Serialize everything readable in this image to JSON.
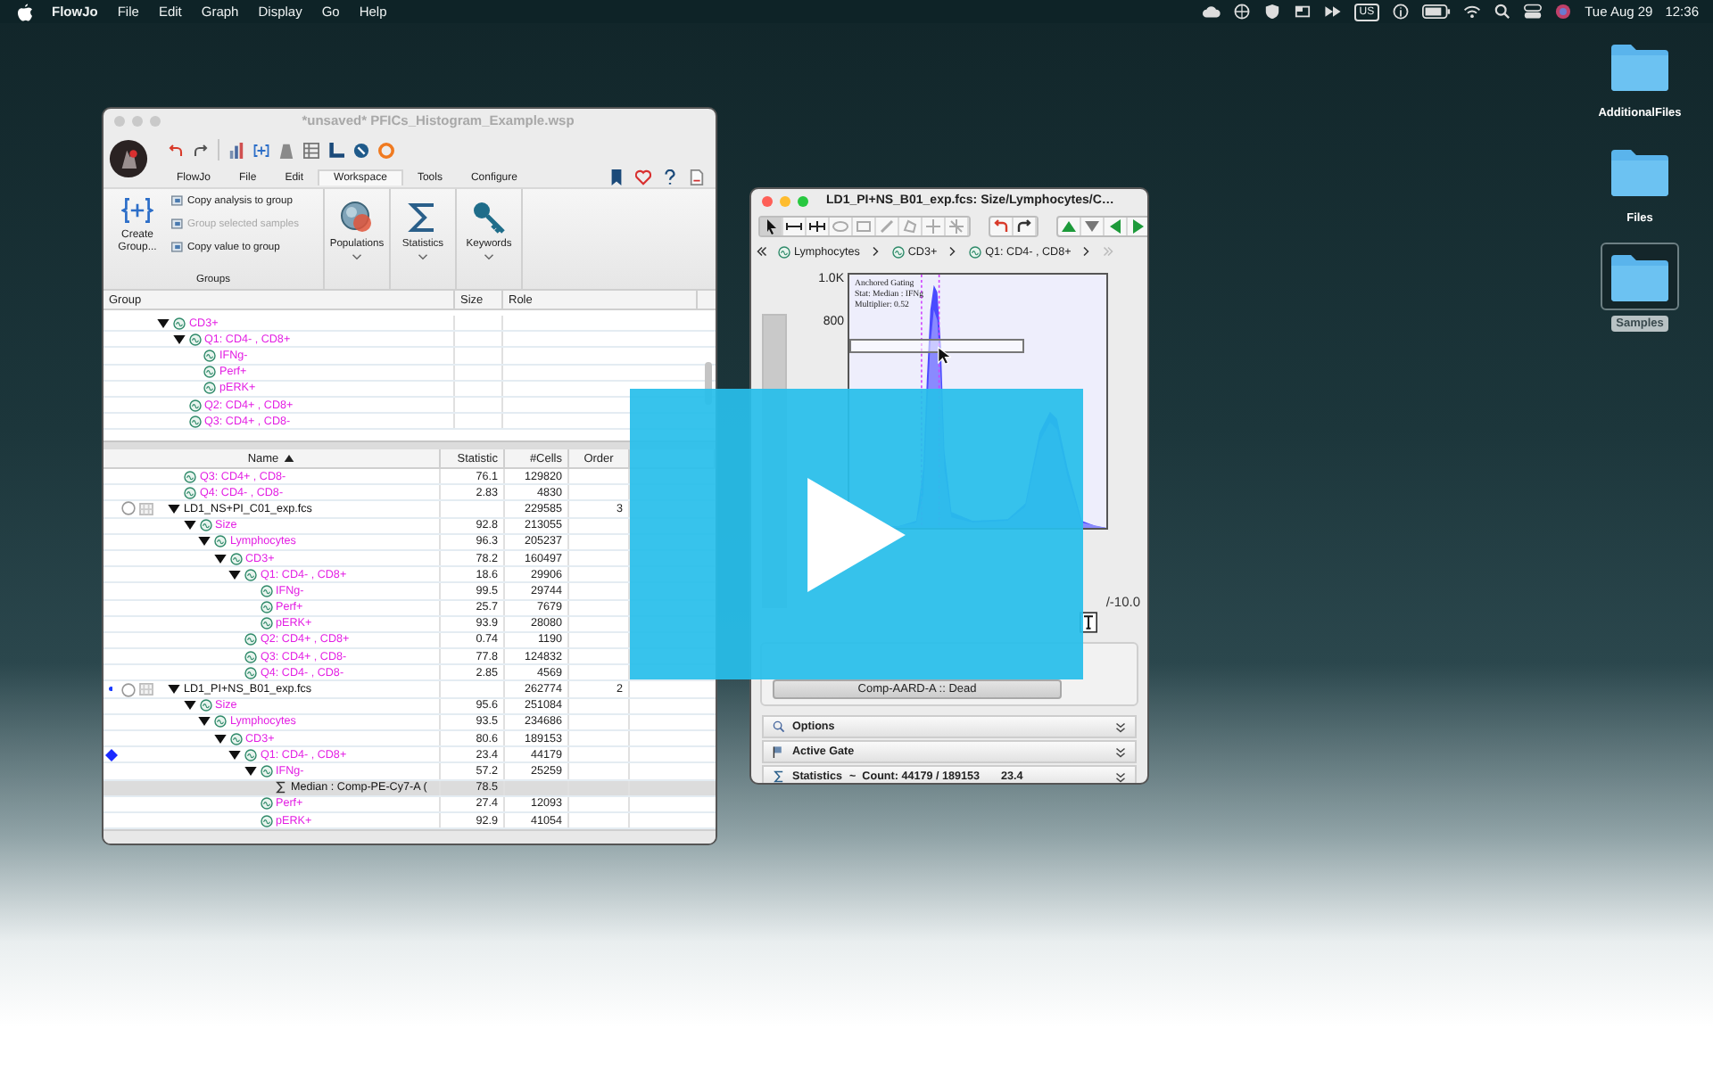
{
  "menu_bar": {
    "app_name": "FlowJo",
    "menus": [
      "File",
      "Edit",
      "Graph",
      "Display",
      "Go",
      "Help"
    ],
    "input_source": "US",
    "date": "Tue Aug 29",
    "time": "12:36"
  },
  "desktop_icons": [
    {
      "label": "AdditionalFiles",
      "selected": false
    },
    {
      "label": "Files",
      "selected": false
    },
    {
      "label": "Samples",
      "selected": true
    }
  ],
  "workspace_window": {
    "title": "*unsaved* PFICs_Histogram_Example.wsp",
    "ribbon_tabs": [
      {
        "label": "FlowJo",
        "selected": false
      },
      {
        "label": "File",
        "selected": false
      },
      {
        "label": "Edit",
        "selected": false
      },
      {
        "label": "Workspace",
        "selected": true
      },
      {
        "label": "Tools",
        "selected": false
      },
      {
        "label": "Configure",
        "selected": false
      }
    ],
    "create_group": "Create Group...",
    "group_actions": [
      {
        "label": "Copy analysis to group",
        "disabled": false
      },
      {
        "label": "Group selected samples",
        "disabled": true
      },
      {
        "label": "Copy value to group",
        "disabled": false
      }
    ],
    "groups_label": "Groups",
    "tools": [
      {
        "label": "Populations",
        "kind": "populations"
      },
      {
        "label": "Statistics",
        "kind": "statistics"
      },
      {
        "label": "Keywords",
        "kind": "keywords"
      }
    ]
  },
  "group_table": {
    "columns": [
      "Group",
      "Size",
      "Role"
    ],
    "rows": [
      {
        "label": "CD3+",
        "kind": "gate",
        "expanded": true,
        "children": [
          {
            "label": "Q1: CD4- , CD8+",
            "kind": "gate",
            "expanded": true,
            "children": [
              {
                "label": "IFNg-",
                "kind": "gate"
              },
              {
                "label": "Perf+",
                "kind": "gate"
              },
              {
                "label": "pERK+",
                "kind": "gate"
              }
            ]
          },
          {
            "label": "Q2: CD4+ , CD8+",
            "kind": "gate"
          },
          {
            "label": "Q3: CD4+ , CD8-",
            "kind": "gate"
          }
        ]
      }
    ]
  },
  "sample_table": {
    "columns": [
      {
        "label": "Name",
        "sorted": true
      },
      {
        "label": "Statistic",
        "sorted": false
      },
      {
        "label": "#Cells",
        "sorted": false
      },
      {
        "label": "Order",
        "sorted": false
      }
    ],
    "rows": [
      {
        "label": "Q3: CD4+ , CD8-",
        "kind": "gate",
        "statistic": "76.1",
        "cells": "129820",
        "selected": false
      },
      {
        "label": "Q4: CD4- , CD8-",
        "kind": "gate",
        "statistic": "2.83",
        "cells": "4830",
        "selected": false
      },
      {
        "label": "LD1_NS+PI_C01_exp.fcs",
        "kind": "sample",
        "cells": "229585",
        "order": "3",
        "selected": false,
        "expanded": true,
        "children": [
          {
            "label": "Size",
            "kind": "gate",
            "statistic": "92.8",
            "cells": "213055",
            "selected": false,
            "expanded": true,
            "children": [
              {
                "label": "Lymphocytes",
                "kind": "gate",
                "statistic": "96.3",
                "cells": "205237",
                "selected": false,
                "expanded": true,
                "children": [
                  {
                    "label": "CD3+",
                    "kind": "gate",
                    "statistic": "78.2",
                    "cells": "160497",
                    "selected": false,
                    "expanded": true,
                    "children": [
                      {
                        "label": "Q1: CD4- , CD8+",
                        "kind": "gate",
                        "statistic": "18.6",
                        "cells": "29906",
                        "selected": false,
                        "expanded": true,
                        "children": [
                          {
                            "label": "IFNg-",
                            "kind": "gate",
                            "statistic": "99.5",
                            "cells": "29744",
                            "selected": false
                          },
                          {
                            "label": "Perf+",
                            "kind": "gate",
                            "statistic": "25.7",
                            "cells": "7679",
                            "selected": false
                          },
                          {
                            "label": "pERK+",
                            "kind": "gate",
                            "statistic": "93.9",
                            "cells": "28080",
                            "selected": false
                          }
                        ]
                      },
                      {
                        "label": "Q2: CD4+ , CD8+",
                        "kind": "gate",
                        "statistic": "0.74",
                        "cells": "1190",
                        "selected": false
                      },
                      {
                        "label": "Q3: CD4+ , CD8-",
                        "kind": "gate",
                        "statistic": "77.8",
                        "cells": "124832",
                        "selected": false
                      },
                      {
                        "label": "Q4: CD4- , CD8-",
                        "kind": "gate",
                        "statistic": "2.85",
                        "cells": "4569",
                        "selected": false
                      }
                    ]
                  }
                ]
              }
            ]
          }
        ]
      },
      {
        "label": "LD1_PI+NS_B01_exp.fcs",
        "kind": "sample",
        "cells": "262774",
        "order": "2",
        "selected": false,
        "current": true,
        "expanded": true,
        "children": [
          {
            "label": "Size",
            "kind": "gate",
            "statistic": "95.6",
            "cells": "251084",
            "selected": false,
            "expanded": true,
            "children": [
              {
                "label": "Lymphocytes",
                "kind": "gate",
                "statistic": "93.5",
                "cells": "234686",
                "selected": false,
                "expanded": true,
                "children": [
                  {
                    "label": "CD3+",
                    "kind": "gate",
                    "statistic": "80.6",
                    "cells": "189153",
                    "selected": false,
                    "expanded": true,
                    "children": [
                      {
                        "label": "Q1: CD4- , CD8+",
                        "kind": "gate",
                        "statistic": "23.4",
                        "cells": "44179",
                        "selected": false,
                        "flagged": true,
                        "expanded": true,
                        "children": [
                          {
                            "label": "IFNg-",
                            "kind": "gate",
                            "statistic": "57.2",
                            "cells": "25259",
                            "selected": false,
                            "expanded": true,
                            "children": [
                              {
                                "label": "Median : Comp-PE-Cy7-A (",
                                "kind": "stat",
                                "statistic": "78.5",
                                "selected": true
                              }
                            ]
                          },
                          {
                            "label": "Perf+",
                            "kind": "gate",
                            "statistic": "27.4",
                            "cells": "12093",
                            "selected": false
                          },
                          {
                            "label": "pERK+",
                            "kind": "gate",
                            "statistic": "92.9",
                            "cells": "41054",
                            "selected": false
                          }
                        ]
                      }
                    ]
                  }
                ]
              }
            ]
          }
        ]
      }
    ]
  },
  "graph_window": {
    "title": "LD1_PI+NS_B01_exp.fcs: Size/Lymphocytes/C…",
    "breadcrumb": [
      "Lymphocytes",
      "CD3+",
      "Q1: CD4- , CD8+"
    ],
    "y_ticks": [
      "1.0K",
      "800"
    ],
    "gate_note": [
      "Anchored Gating",
      "Stat: Median : IFNg",
      "Multiplier: 0.52"
    ],
    "formula_tail": "/-10.0",
    "axis_button": "Comp-AARD-A :: Dead",
    "panels": [
      {
        "label": "Options",
        "kind": "options"
      },
      {
        "label": "Active Gate",
        "kind": "gate"
      },
      {
        "label": "Statistics",
        "kind": "statistics",
        "detail": "~  Count: 44179 / 189153",
        "value": "23.4"
      }
    ]
  }
}
